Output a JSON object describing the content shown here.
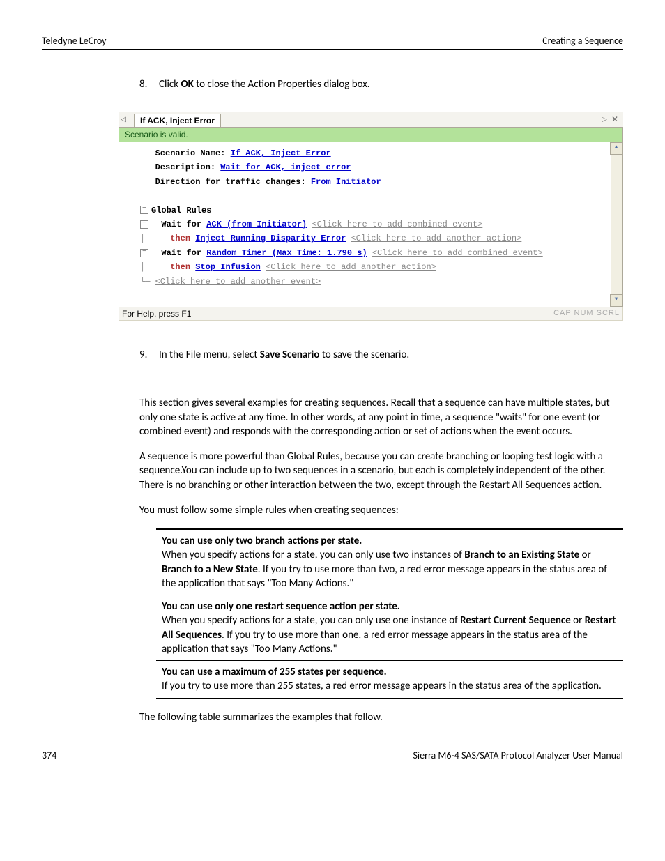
{
  "header": {
    "left": "Teledyne LeCroy",
    "right": "Creating a Sequence"
  },
  "step8": {
    "num": "8.",
    "pre": "Click ",
    "bold": "OK",
    "post": " to close the Action Properties dialog box."
  },
  "screenshot": {
    "tab_title": "If ACK, Inject Error",
    "status": "Scenario is valid.",
    "scenario_name_label": "Scenario Name: ",
    "scenario_name_value": "If ACK, Inject Error",
    "description_label": "Description: ",
    "description_value": "Wait for ACK, inject error",
    "direction_label": "Direction for traffic changes: ",
    "direction_value": "From Initiator",
    "global_rules": "Global Rules",
    "rule1_waitfor": "Wait for",
    "rule1_event": "ACK (from Initiator)",
    "rule1_placeholder": "<Click here to add combined event>",
    "rule1_then": "then",
    "rule1_action": "Inject Running Disparity Error",
    "rule1_action_placeholder": "<Click here to add another action>",
    "rule2_waitfor": "Wait for",
    "rule2_event": "Random Timer (Max Time: 1.790 s)",
    "rule2_placeholder": "<Click here to add combined event>",
    "rule2_then": "then",
    "rule2_action": "Stop Infusion",
    "rule2_action_placeholder": "<Click here to add another action>",
    "add_event_placeholder": "<Click here to add another event>",
    "statusbar_left": "For Help, press F1",
    "statusbar_right": "CAP NUM SCRL"
  },
  "step9": {
    "num": "9.",
    "pre": "In the File menu, select ",
    "bold": "Save Scenario",
    "post": " to save the scenario."
  },
  "para1": "This section gives several examples for creating sequences. Recall that a sequence can have multiple states, but only one state is active at any time. In other words, at any point in time, a sequence \"waits\" for one event (or combined event) and responds with the corresponding action or set of actions when the event occurs.",
  "para2": "A sequence is more powerful than Global Rules, because you can create branching or looping test logic with a sequence.You can include up to two sequences in a scenario, but each is completely independent of the other. There is no branching or other interaction between the two, except through the Restart All Sequences action.",
  "para3": "You must follow some simple rules when creating sequences:",
  "rules": [
    {
      "title": "You can use only two branch actions per state.",
      "body_pre": "When you specify actions for a state, you can only use two instances of ",
      "b1": "Branch to an Existing State",
      "mid": " or ",
      "b2": "Branch to a New State",
      "body_post": ". If you try to use more than two, a red error message appears in the status area of the application that says \"Too Many Actions.\""
    },
    {
      "title": "You can use only one restart sequence action per state.",
      "body_pre": "When you specify actions for a state, you can only use one instance of ",
      "b1": "Restart Current Sequence",
      "mid": " or ",
      "b2": "Restart All Sequences",
      "body_post": ". If you try to use more than one, a red error message appears in the status area of the application that says \"Too Many Actions.\""
    },
    {
      "title": "You can use a maximum of 255 states per sequence.",
      "body_pre": "If you try to use more than 255 states, a red error message appears in the status area of the application.",
      "b1": "",
      "mid": "",
      "b2": "",
      "body_post": ""
    }
  ],
  "para4": "The following table summarizes the examples that follow.",
  "footer": {
    "left": "374",
    "right": "Sierra M6-4 SAS/SATA Protocol Analyzer User Manual"
  }
}
